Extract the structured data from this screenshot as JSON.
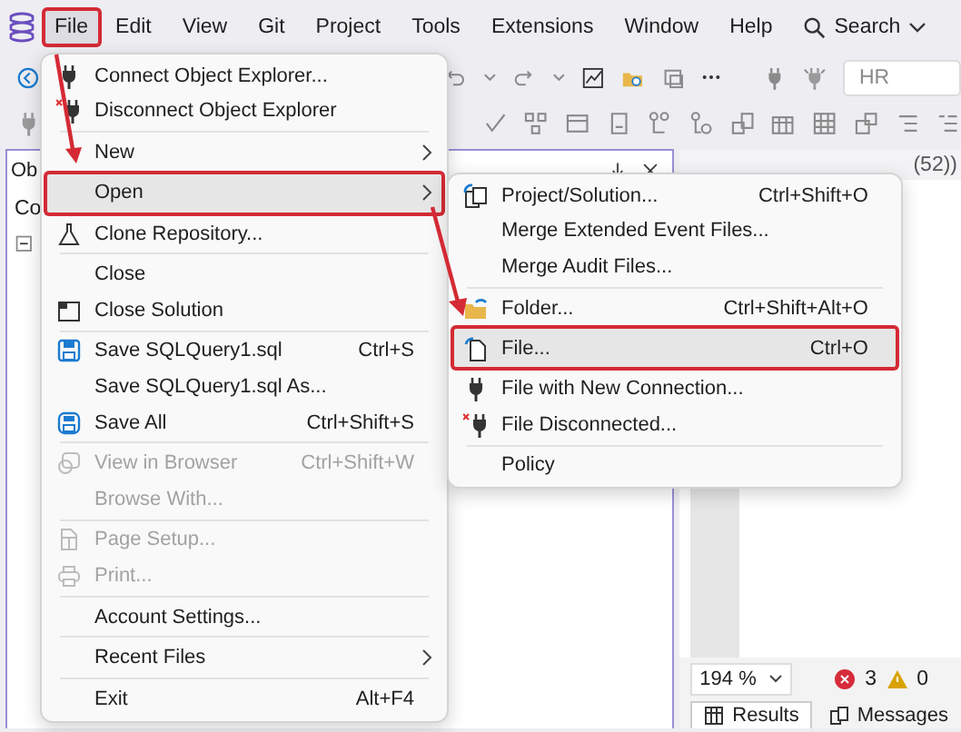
{
  "menu_bar": {
    "items": [
      {
        "kind": "menu",
        "label": "File",
        "selected": true,
        "callout": true
      },
      {
        "kind": "menu",
        "label": "Edit",
        "selected": false,
        "callout": false
      },
      {
        "kind": "menu",
        "label": "View",
        "selected": false,
        "callout": false
      },
      {
        "kind": "menu",
        "label": "Git",
        "selected": false,
        "callout": false
      },
      {
        "kind": "menu",
        "label": "Project",
        "selected": false,
        "callout": false
      },
      {
        "kind": "menu",
        "label": "Tools",
        "selected": false,
        "callout": false
      },
      {
        "kind": "menu",
        "label": "Extensions",
        "selected": false,
        "callout": false
      },
      {
        "kind": "menu",
        "label": "Window",
        "selected": false,
        "callout": false
      },
      {
        "kind": "menu",
        "label": "Help",
        "selected": false,
        "callout": false
      },
      {
        "kind": "search",
        "label": "Search",
        "selected": false,
        "callout": false
      }
    ]
  },
  "toolbar": {
    "server_field": {
      "value": "HR"
    }
  },
  "object_explorer": {
    "title": "Ob",
    "row": "Co"
  },
  "editor": {
    "tab_title": "(52))",
    "zoom": "194 %",
    "errors": "3",
    "warnings": "0",
    "result_tabs": [
      {
        "label": "Results",
        "selected": true
      },
      {
        "label": "Messages",
        "selected": false
      }
    ]
  },
  "file_menu": {
    "items": [
      {
        "kind": "item",
        "label": "Connect Object Explorer...",
        "disabled": false,
        "submenu": false,
        "selected": false,
        "callout": false
      },
      {
        "kind": "item",
        "label": "Disconnect Object Explorer",
        "disabled": false,
        "submenu": false,
        "selected": false,
        "callout": false
      },
      {
        "kind": "separator"
      },
      {
        "kind": "item",
        "label": "New",
        "disabled": false,
        "submenu": true,
        "selected": false,
        "callout": false
      },
      {
        "kind": "item",
        "label": "Open",
        "disabled": false,
        "submenu": true,
        "selected": true,
        "callout": true
      },
      {
        "kind": "item",
        "label": "Clone Repository...",
        "disabled": false,
        "submenu": false,
        "selected": false,
        "callout": false
      },
      {
        "kind": "separator"
      },
      {
        "kind": "item",
        "label": "Close",
        "disabled": false,
        "submenu": false,
        "selected": false,
        "callout": false
      },
      {
        "kind": "item",
        "label": "Close Solution",
        "disabled": false,
        "submenu": false,
        "selected": false,
        "callout": false
      },
      {
        "kind": "separator"
      },
      {
        "kind": "item",
        "label": "Save SQLQuery1.sql",
        "shortcut": "Ctrl+S",
        "disabled": false,
        "submenu": false,
        "selected": false,
        "callout": false
      },
      {
        "kind": "item",
        "label": "Save SQLQuery1.sql As...",
        "disabled": false,
        "submenu": false,
        "selected": false,
        "callout": false
      },
      {
        "kind": "item",
        "label": "Save All",
        "shortcut": "Ctrl+Shift+S",
        "disabled": false,
        "submenu": false,
        "selected": false,
        "callout": false
      },
      {
        "kind": "separator"
      },
      {
        "kind": "item",
        "label": "View in Browser",
        "shortcut": "Ctrl+Shift+W",
        "disabled": true,
        "submenu": false,
        "selected": false,
        "callout": false
      },
      {
        "kind": "item",
        "label": "Browse With...",
        "disabled": true,
        "submenu": false,
        "selected": false,
        "callout": false
      },
      {
        "kind": "separator"
      },
      {
        "kind": "item",
        "label": "Page Setup...",
        "disabled": true,
        "submenu": false,
        "selected": false,
        "callout": false
      },
      {
        "kind": "item",
        "label": "Print...",
        "disabled": true,
        "submenu": false,
        "selected": false,
        "callout": false
      },
      {
        "kind": "separator"
      },
      {
        "kind": "item",
        "label": "Account Settings...",
        "disabled": false,
        "submenu": false,
        "selected": false,
        "callout": false
      },
      {
        "kind": "separator"
      },
      {
        "kind": "item",
        "label": "Recent Files",
        "disabled": false,
        "submenu": true,
        "selected": false,
        "callout": false
      },
      {
        "kind": "separator"
      },
      {
        "kind": "item",
        "label": "Exit",
        "shortcut": "Alt+F4",
        "disabled": false,
        "submenu": false,
        "selected": false,
        "callout": false
      }
    ]
  },
  "open_submenu": {
    "items": [
      {
        "kind": "item",
        "label": "Project/Solution...",
        "shortcut": "Ctrl+Shift+O",
        "disabled": false,
        "submenu": false,
        "selected": false,
        "callout": false
      },
      {
        "kind": "item",
        "label": "Merge Extended Event Files...",
        "disabled": false,
        "submenu": false,
        "selected": false,
        "callout": false
      },
      {
        "kind": "item",
        "label": "Merge Audit Files...",
        "disabled": false,
        "submenu": false,
        "selected": false,
        "callout": false
      },
      {
        "kind": "separator"
      },
      {
        "kind": "item",
        "label": "Folder...",
        "shortcut": "Ctrl+Shift+Alt+O",
        "disabled": false,
        "submenu": false,
        "selected": false,
        "callout": false
      },
      {
        "kind": "item",
        "label": "File...",
        "shortcut": "Ctrl+O",
        "disabled": false,
        "submenu": false,
        "selected": true,
        "callout": true
      },
      {
        "kind": "item",
        "label": "File with New Connection...",
        "disabled": false,
        "submenu": false,
        "selected": false,
        "callout": false
      },
      {
        "kind": "item",
        "label": "File Disconnected...",
        "disabled": false,
        "submenu": false,
        "selected": false,
        "callout": false
      },
      {
        "kind": "separator"
      },
      {
        "kind": "item",
        "label": "Policy",
        "disabled": false,
        "submenu": false,
        "selected": false,
        "callout": false
      }
    ]
  }
}
